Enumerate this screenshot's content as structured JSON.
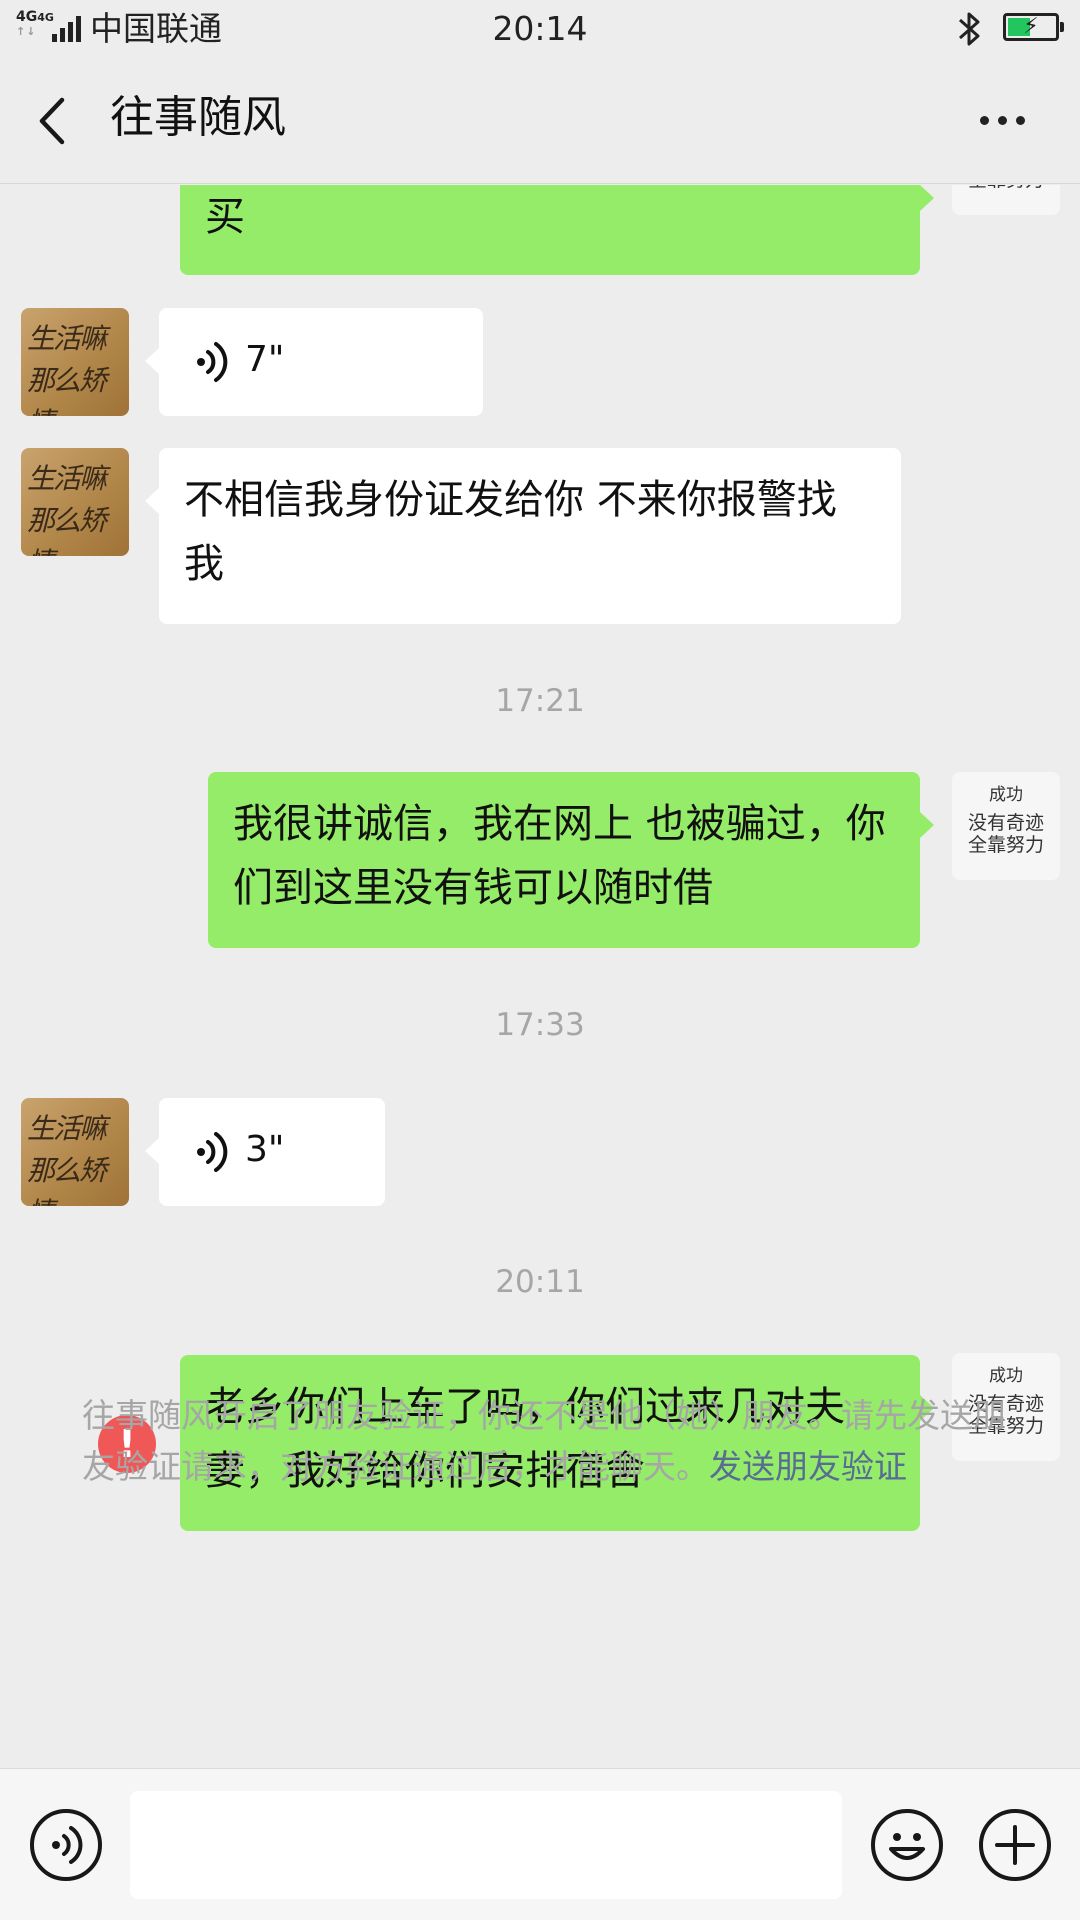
{
  "status_bar": {
    "network": "4G",
    "network2": "4G",
    "carrier": "中国联通",
    "time": "20:14",
    "icons": [
      "signal-icon",
      "bluetooth-icon",
      "battery-charging-icon"
    ],
    "battery_color": "#22c55e"
  },
  "header": {
    "title": "往事随风",
    "back_icon": "chevron-left-icon",
    "more_icon": "more-dots-icon"
  },
  "avatars": {
    "contact_calligraphy": [
      "生活嘛",
      "那么矫情"
    ],
    "self_lines": [
      "成功",
      "没有奇迹",
      "全靠努力"
    ]
  },
  "messages": {
    "m1_text": "买",
    "m2_voice_duration": "7\"",
    "m3_text": "不相信我身份证发给你 不来你报警找我",
    "time1": "17:21",
    "m4_text": "我很讲诚信，我在网上 也被骗过，你们到这里没有钱可以随时借",
    "time2": "17:33",
    "m5_voice_duration": "3\"",
    "time3": "20:11",
    "m6_text": "老乡你们上车了吗，你们过来几对夫妻，我好给你们安排宿舍",
    "m6_status_icon": "send-failed-icon",
    "m6_status_mark": "!"
  },
  "notice": {
    "text": "往事随风开启了朋友验证，你还不是他（她）朋友。请先发送朋友验证请求，对方验证通过后，才能聊天。",
    "link": "发送朋友验证"
  },
  "input_bar": {
    "voice_icon": "voice-mode-icon",
    "emoji_icon": "emoji-icon",
    "plus_icon": "plus-icon",
    "input_value": ""
  },
  "colors": {
    "background": "#ededed",
    "outgoing_bubble": "#95ec69",
    "incoming_bubble": "#ffffff",
    "link": "#586c94",
    "error": "#f05858"
  }
}
